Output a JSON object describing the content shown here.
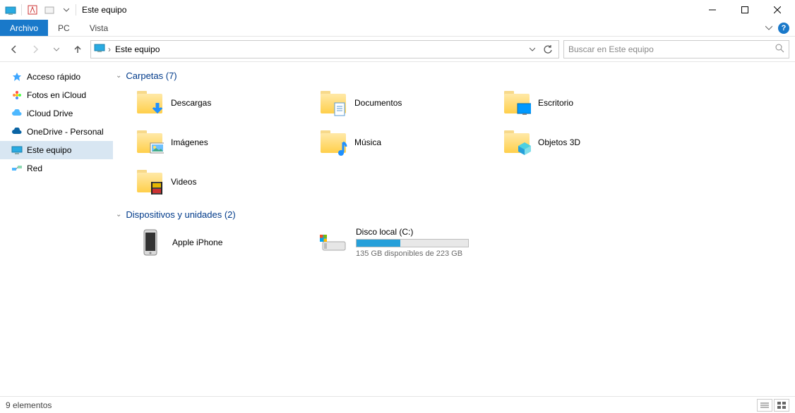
{
  "window": {
    "title": "Este equipo"
  },
  "menubar": {
    "file": "Archivo",
    "tabs": [
      "PC",
      "Vista"
    ]
  },
  "address": {
    "crumb": "Este equipo",
    "chevron": "›"
  },
  "search": {
    "placeholder": "Buscar en Este equipo"
  },
  "sidebar": {
    "items": [
      {
        "label": "Acceso rápido"
      },
      {
        "label": "Fotos en iCloud"
      },
      {
        "label": "iCloud Drive"
      },
      {
        "label": "OneDrive - Personal"
      },
      {
        "label": "Este equipo"
      },
      {
        "label": "Red"
      }
    ]
  },
  "groups": {
    "folders": {
      "header": "Carpetas (7)",
      "items": [
        {
          "label": "Descargas",
          "overlay": "download"
        },
        {
          "label": "Documentos",
          "overlay": "document"
        },
        {
          "label": "Escritorio",
          "overlay": "desktop"
        },
        {
          "label": "Imágenes",
          "overlay": "picture"
        },
        {
          "label": "Música",
          "overlay": "music"
        },
        {
          "label": "Objetos 3D",
          "overlay": "cube"
        },
        {
          "label": "Videos",
          "overlay": "video"
        }
      ]
    },
    "devices": {
      "header": "Dispositivos y unidades (2)",
      "items": [
        {
          "type": "phone",
          "label": "Apple iPhone"
        },
        {
          "type": "drive",
          "label": "Disco local (C:)",
          "sub": "135 GB disponibles de 223 GB",
          "usage_percent": 39
        }
      ]
    }
  },
  "status": {
    "text": "9 elementos"
  }
}
